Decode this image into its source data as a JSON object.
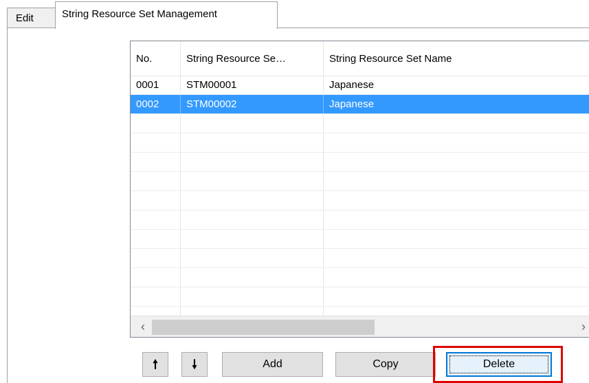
{
  "tabs": [
    {
      "label": "Edit",
      "active": false
    },
    {
      "label": "String Resource Set Management",
      "active": true
    }
  ],
  "list": {
    "columns": [
      "No.",
      "String Resource Se…",
      "String Resource Set Name"
    ],
    "rows": [
      {
        "no": "0001",
        "id": "STM00001",
        "name": "Japanese",
        "selected": false
      },
      {
        "no": "0002",
        "id": "STM00002",
        "name": "Japanese",
        "selected": true
      }
    ],
    "empty_row_count": 11,
    "scroll_left_icon": "chevron-left-icon",
    "scroll_right_icon": "chevron-right-icon",
    "selection_color": "#3399ff"
  },
  "buttons": {
    "move_up_icon": "arrow-up-icon",
    "move_down_icon": "arrow-down-icon",
    "add_label": "Add",
    "copy_label": "Copy",
    "delete_label": "Delete"
  },
  "highlight_color": "#e00000"
}
